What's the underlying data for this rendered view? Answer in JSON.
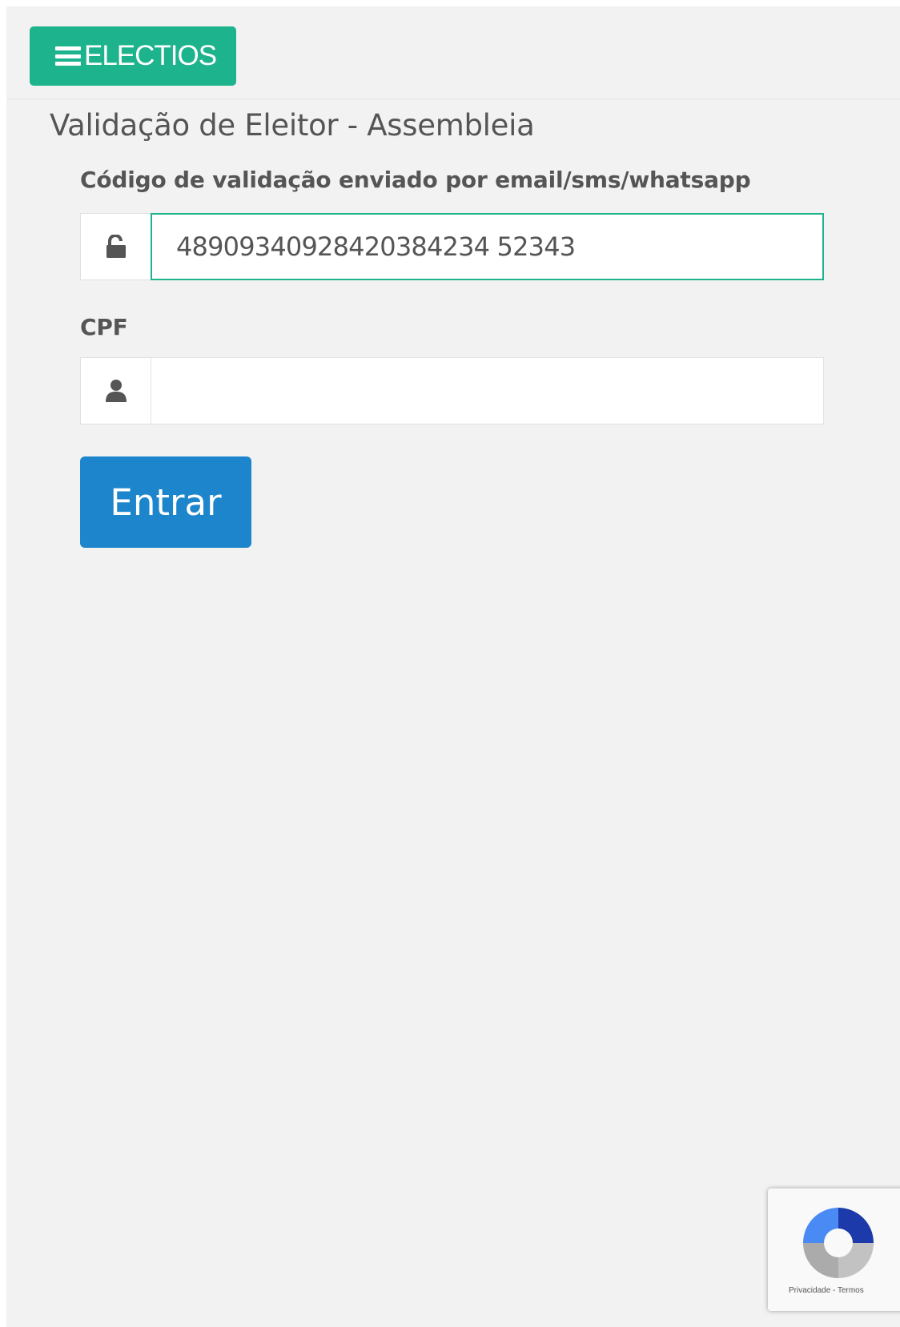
{
  "header": {
    "brand_label": "ELECTIOS",
    "brand_color": "#1cb38d",
    "menu_icon": "bars-icon"
  },
  "page": {
    "title": "Validação de Eleitor - Assembleia"
  },
  "form": {
    "code": {
      "label": "Código de validação enviado por email/sms/whatsapp",
      "value": "48909340928420384234 52343",
      "icon": "unlock-icon"
    },
    "cpf": {
      "label": "CPF",
      "value": "",
      "icon": "user-icon"
    },
    "submit_label": "Entrar",
    "submit_color": "#1d85cb"
  },
  "recaptcha": {
    "links": "Privacidade - Termos"
  }
}
